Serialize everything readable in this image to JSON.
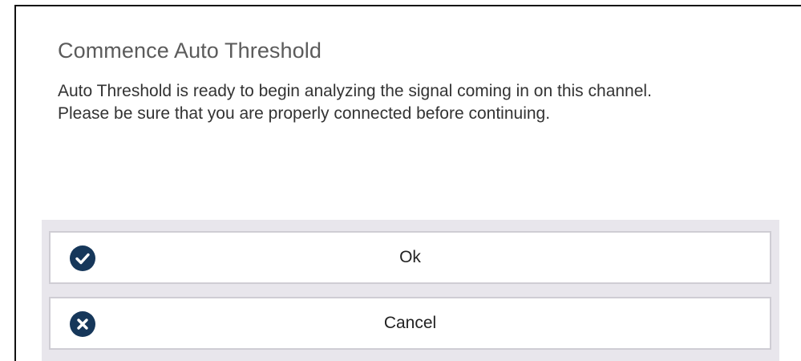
{
  "dialog": {
    "title": "Commence Auto Threshold",
    "message_lines": [
      "Auto Threshold is ready to begin analyzing the signal coming in on this channel.",
      "Please be sure that you are properly connected before continuing."
    ]
  },
  "buttons": {
    "ok": {
      "label": "Ok",
      "icon": "check-circle-icon"
    },
    "cancel": {
      "label": "Cancel",
      "icon": "x-circle-icon"
    }
  },
  "colors": {
    "icon_fill": "#16375a",
    "actions_background": "#e8e6ec",
    "title_text": "#5b5b5b"
  }
}
